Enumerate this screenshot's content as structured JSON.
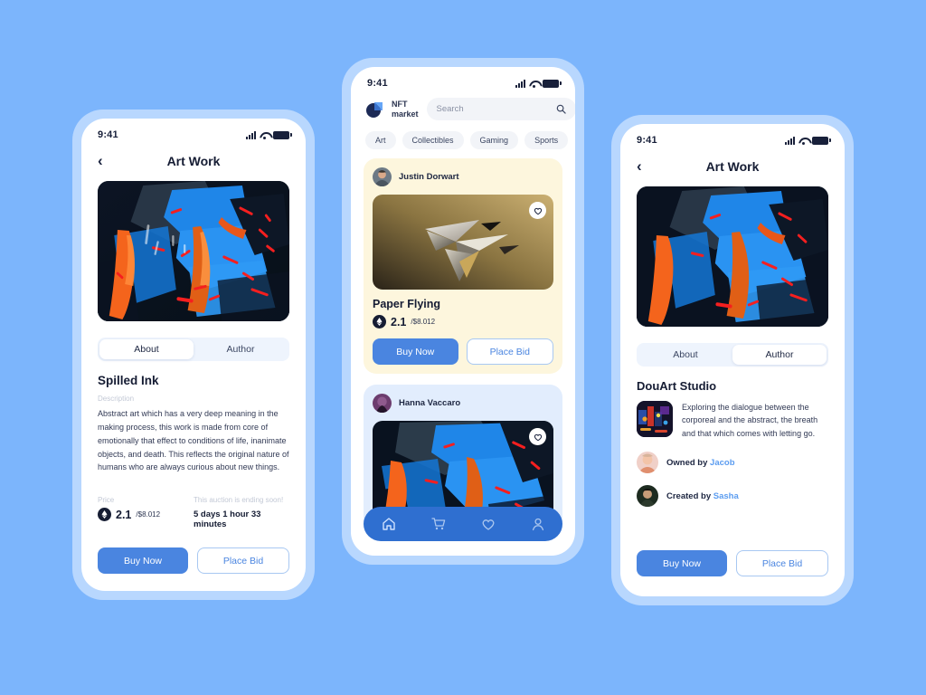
{
  "colors": {
    "background": "#7cb5fc",
    "phone_frame": "#b8d7fe",
    "primary_button": "#4a85e0",
    "nav_bar": "#2f6fd0",
    "link": "#5b9cf0",
    "card_cream": "#fdf6dd",
    "card_blue": "#e2edfd"
  },
  "status_bar": {
    "time": "9:41"
  },
  "detail_left": {
    "nav": {
      "back_icon": "chevron-left-icon",
      "title": "Art Work"
    },
    "tabs": [
      {
        "label": "About",
        "active": true
      },
      {
        "label": "Author",
        "active": false
      }
    ],
    "art_title": "Spilled Ink",
    "description_label": "Description",
    "description": "Abstract art which has a very deep meaning in the making process, this work is made from core of emotionally that effect to conditions of life, inanimate objects, and death. This reflects the original nature of humans who are always curious about new things.",
    "price_label": "Price",
    "price_value": "2.1",
    "price_usd": "/$8.012",
    "auction_label": "This auction is ending soon!",
    "auction_time": "5 days 1 hour 33 minutes",
    "buy_label": "Buy Now",
    "bid_label": "Place Bid"
  },
  "market": {
    "logo": {
      "line1": "NFT",
      "line2": "market",
      "icon": "nft-logo-icon"
    },
    "search": {
      "value": "",
      "placeholder": "Search",
      "icon": "search-icon"
    },
    "categories": [
      "Art",
      "Collectibles",
      "Gaming",
      "Sports"
    ],
    "cards": [
      {
        "user": "Justin Dorwart",
        "title": "Paper Flying",
        "price_value": "2.1",
        "price_usd": "/$8.012",
        "buy_label": "Buy Now",
        "bid_label": "Place Bid",
        "theme": "cream",
        "art": "paper-plane-gold"
      },
      {
        "user": "Hanna Vaccaro",
        "title": "",
        "price_value": "",
        "price_usd": "",
        "buy_label": "",
        "bid_label": "",
        "theme": "bluish",
        "art": "spilled-ink"
      }
    ],
    "bottom_nav": [
      {
        "icon": "home-icon",
        "active": true
      },
      {
        "icon": "cart-icon",
        "active": false
      },
      {
        "icon": "heart-icon",
        "active": false
      },
      {
        "icon": "profile-icon",
        "active": false
      }
    ]
  },
  "detail_right": {
    "nav": {
      "back_icon": "chevron-left-icon",
      "title": "Art Work"
    },
    "tabs": [
      {
        "label": "About",
        "active": false
      },
      {
        "label": "Author",
        "active": true
      }
    ],
    "author_name": "DouArt Studio",
    "author_description": "Exploring the dialogue between the corporeal and the abstract, the breath and that which comes with letting go.",
    "owned_prefix": "Owned by ",
    "owned_by": "Jacob",
    "created_prefix": "Created by ",
    "created_by": "Sasha",
    "buy_label": "Buy Now",
    "bid_label": "Place Bid"
  }
}
